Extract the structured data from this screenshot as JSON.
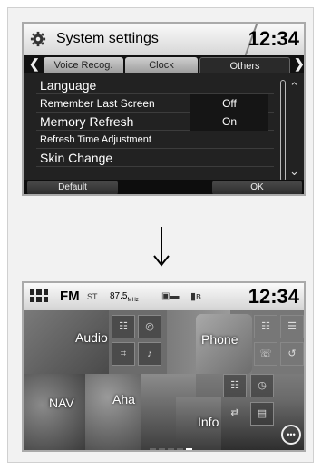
{
  "settings_screen": {
    "title": "System settings",
    "clock": "12:34",
    "tabs": [
      {
        "label": "Voice Recog."
      },
      {
        "label": "Clock"
      },
      {
        "label": "Others"
      }
    ],
    "rows": [
      {
        "label": "Language",
        "value": ""
      },
      {
        "label": "Remember Last Screen",
        "value": "Off"
      },
      {
        "label": "Memory Refresh",
        "value": "On"
      },
      {
        "label": "Refresh Time Adjustment",
        "value": ""
      },
      {
        "label": "Skin Change",
        "value": ""
      }
    ],
    "default_label": "Default",
    "ok_label": "OK"
  },
  "home_screen": {
    "band": "FM",
    "band_icon_text": "ST",
    "frequency": "87.5",
    "frequency_unit": "MHz",
    "clock": "12:34",
    "tiles": {
      "audio": "Audio",
      "phone": "Phone",
      "nav": "NAV",
      "aha": "Aha",
      "info": "Info"
    },
    "more_label": "•••"
  },
  "colors": {
    "header_light": "#e8e8e8",
    "screen_dark": "#222222",
    "active_tab": "#2a2a2a"
  }
}
